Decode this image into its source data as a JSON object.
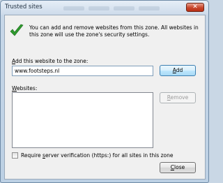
{
  "window": {
    "title": "Trusted sites",
    "close_glyph": "✕"
  },
  "info": {
    "icon": "green-checkmark-icon",
    "text": "You can add and remove websites from this zone. All websites in this zone will use the zone's security settings."
  },
  "add": {
    "label_first": "A",
    "label_rest": "dd this website to the zone:",
    "value": "www.footsteps.nl",
    "button_first": "A",
    "button_rest": "dd"
  },
  "websites": {
    "label_first": "W",
    "label_rest": "ebsites:",
    "items": [],
    "remove_first": "R",
    "remove_rest": "emove"
  },
  "https_option": {
    "label_before": "Require ",
    "label_key": "s",
    "label_after": "erver verification (https:) for all sites in this zone",
    "checked": false
  },
  "close_button": {
    "first": "C",
    "rest": "lose"
  },
  "colors": {
    "accent": "#3c7fb1",
    "check_green": "#2e9a2e",
    "close_red": "#c7452a"
  }
}
